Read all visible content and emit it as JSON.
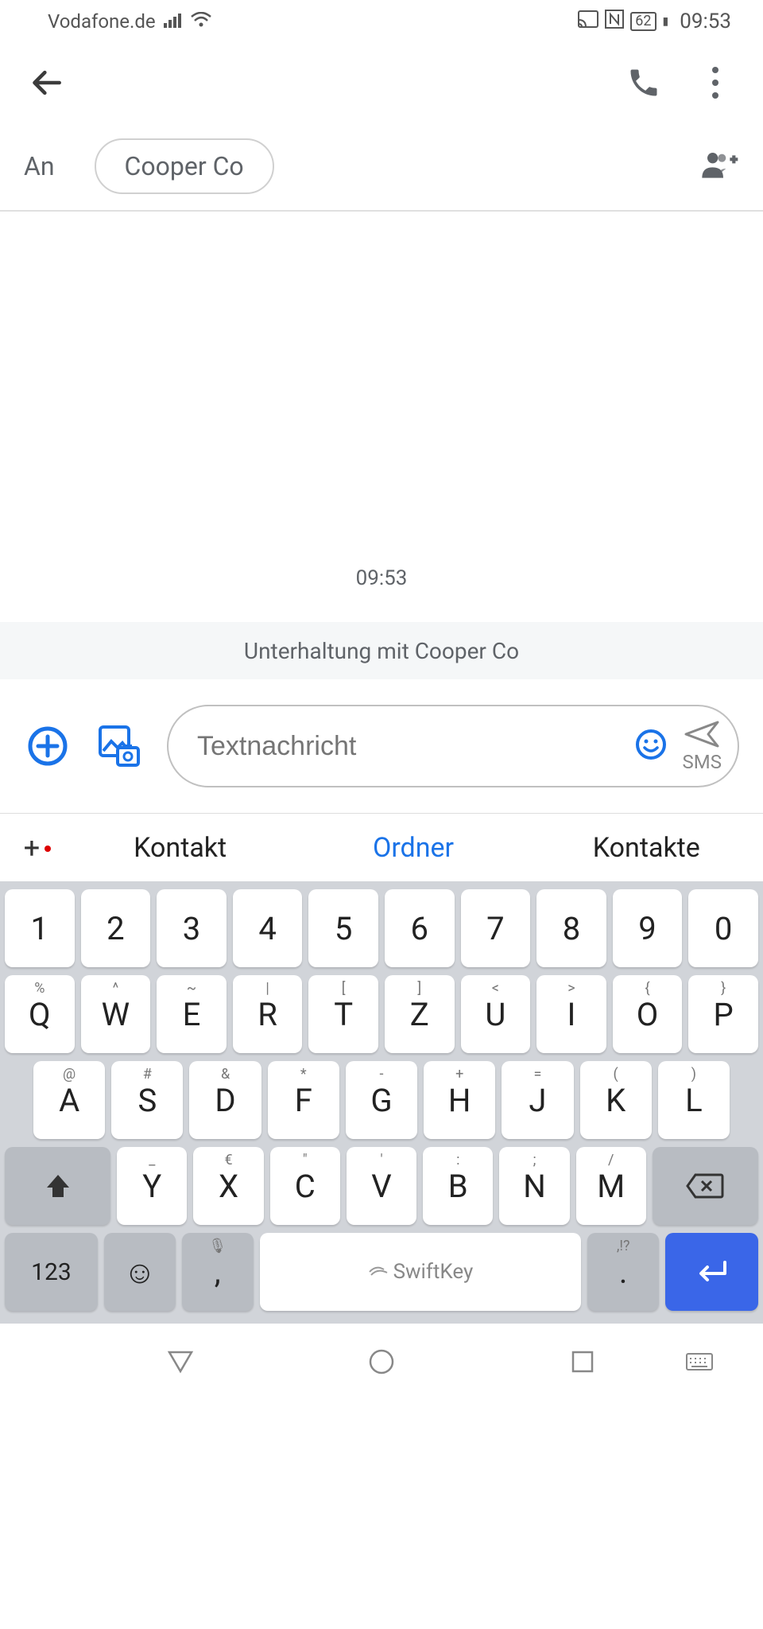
{
  "status": {
    "carrier": "Vodafone.de",
    "battery": "62",
    "time": "09:53"
  },
  "recipient": {
    "label": "An",
    "chip": "Cooper Co"
  },
  "conversation": {
    "timestamp": "09:53",
    "info": "Unterhaltung mit Cooper Co"
  },
  "compose": {
    "placeholder": "Textnachricht",
    "send_label": "SMS"
  },
  "suggestions": {
    "left": "Kontakt",
    "center": "Ordner",
    "right": "Kontakte"
  },
  "keyboard": {
    "row1": [
      "1",
      "2",
      "3",
      "4",
      "5",
      "6",
      "7",
      "8",
      "9",
      "0"
    ],
    "row2": [
      {
        "m": "Q",
        "s": "%"
      },
      {
        "m": "W",
        "s": "^"
      },
      {
        "m": "E",
        "s": "~"
      },
      {
        "m": "R",
        "s": "|"
      },
      {
        "m": "T",
        "s": "["
      },
      {
        "m": "Z",
        "s": "]"
      },
      {
        "m": "U",
        "s": "<"
      },
      {
        "m": "I",
        "s": ">"
      },
      {
        "m": "O",
        "s": "{"
      },
      {
        "m": "P",
        "s": "}"
      }
    ],
    "row3": [
      {
        "m": "A",
        "s": "@"
      },
      {
        "m": "S",
        "s": "#"
      },
      {
        "m": "D",
        "s": "&"
      },
      {
        "m": "F",
        "s": "*"
      },
      {
        "m": "G",
        "s": "-"
      },
      {
        "m": "H",
        "s": "+"
      },
      {
        "m": "J",
        "s": "="
      },
      {
        "m": "K",
        "s": "("
      },
      {
        "m": "L",
        "s": ")"
      }
    ],
    "row4": [
      {
        "m": "Y",
        "s": "_"
      },
      {
        "m": "X",
        "s": "€"
      },
      {
        "m": "C",
        "s": "\""
      },
      {
        "m": "V",
        "s": "'"
      },
      {
        "m": "B",
        "s": ":"
      },
      {
        "m": "N",
        "s": ";"
      },
      {
        "m": "M",
        "s": "/"
      }
    ],
    "num_key": "123",
    "period_sec": ",!?",
    "period_main": ".",
    "comma_sec": "🎤",
    "comma_main": ",",
    "brand": "SwiftKey"
  }
}
